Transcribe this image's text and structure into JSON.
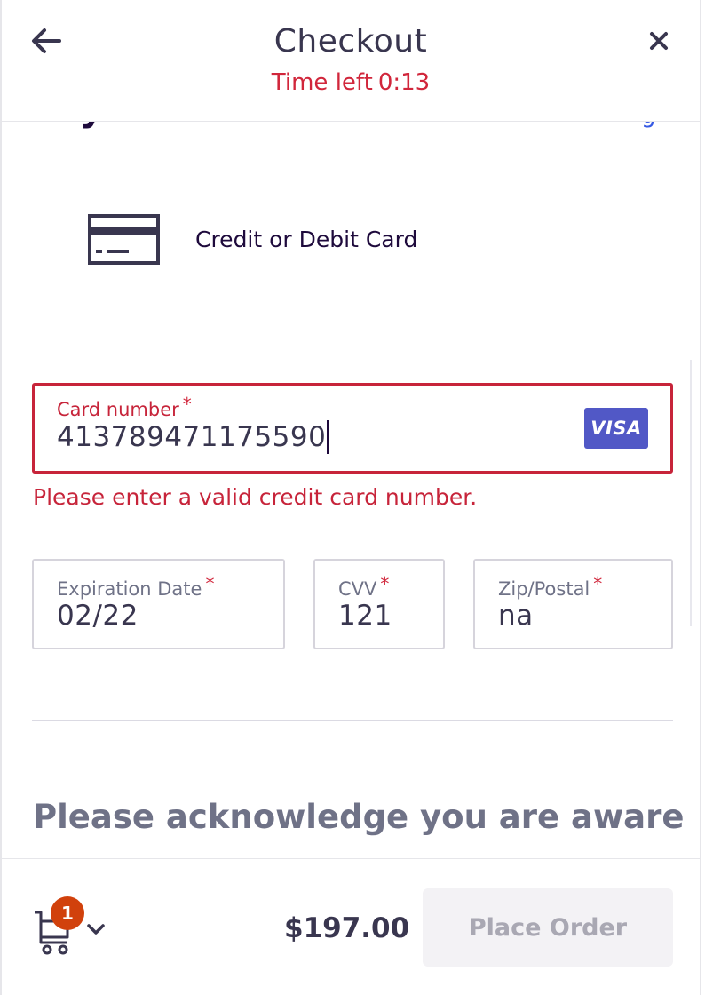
{
  "header": {
    "title": "Checkout",
    "timer_label": "Time left",
    "timer_value": "0:13"
  },
  "payment": {
    "section_heading": "Payment method",
    "option_label": "Credit or Debit Card",
    "card_number_label": "Card number",
    "card_number_value": "413789471175590",
    "card_brand": "VISA",
    "card_number_error": "Please enter a valid credit card number.",
    "expiration_label": "Expiration Date",
    "expiration_value": "02/22",
    "cvv_label": "CVV",
    "cvv_value": "121",
    "zip_label": "Zip/Postal",
    "zip_value": "na",
    "required_marker": "*"
  },
  "acknowledge": {
    "text": "Please acknowledge you are aware"
  },
  "footer": {
    "cart_count": "1",
    "total": "$197.00",
    "place_order_label": "Place Order"
  },
  "colors": {
    "error": "#c7243a",
    "visa_badge": "#5158c6",
    "cart_badge": "#d1410c",
    "button_disabled_bg": "#f3f2f5"
  },
  "icons": {
    "back": "arrow-left-icon",
    "close": "close-icon",
    "card": "credit-card-icon",
    "cart": "cart-icon",
    "chevron": "chevron-down-icon"
  }
}
